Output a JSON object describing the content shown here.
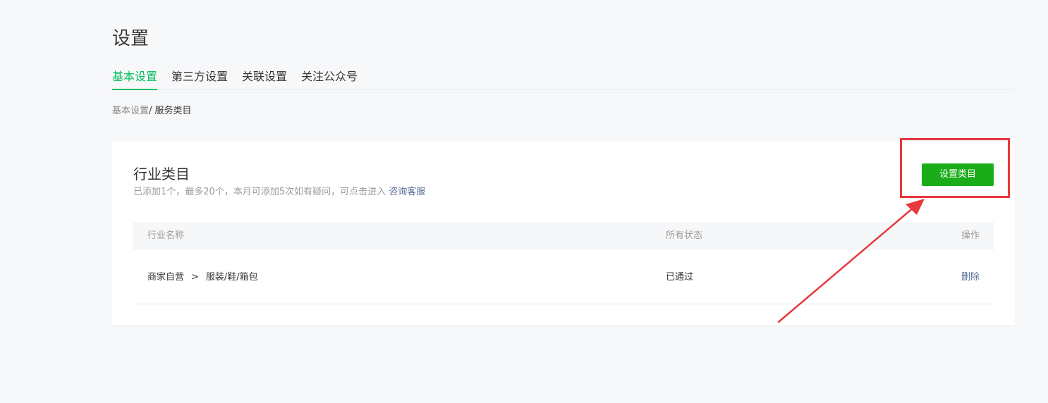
{
  "page": {
    "title": "设置"
  },
  "tabs": [
    {
      "label": "基本设置",
      "active": true
    },
    {
      "label": "第三方设置",
      "active": false
    },
    {
      "label": "关联设置",
      "active": false
    },
    {
      "label": "关注公众号",
      "active": false
    }
  ],
  "breadcrumb": {
    "parent": "基本设置",
    "separator": "/",
    "current": "服务类目"
  },
  "card": {
    "title": "行业类目",
    "description": "已添加1个，最多20个，本月可添加5次如有疑问，可点击进入",
    "help_link": "咨询客服",
    "action_button": "设置类目"
  },
  "table": {
    "columns": [
      "行业名称",
      "所有状态",
      "操作"
    ],
    "rows": [
      {
        "category": "商家自营",
        "separator": ">",
        "subcategory": "服装/鞋/箱包",
        "status": "已通过",
        "action": "删除"
      }
    ]
  },
  "colors": {
    "accent_green": "#07c160",
    "button_green": "#1aad19",
    "link_blue": "#576b95",
    "annotation_red": "#e8383d"
  }
}
